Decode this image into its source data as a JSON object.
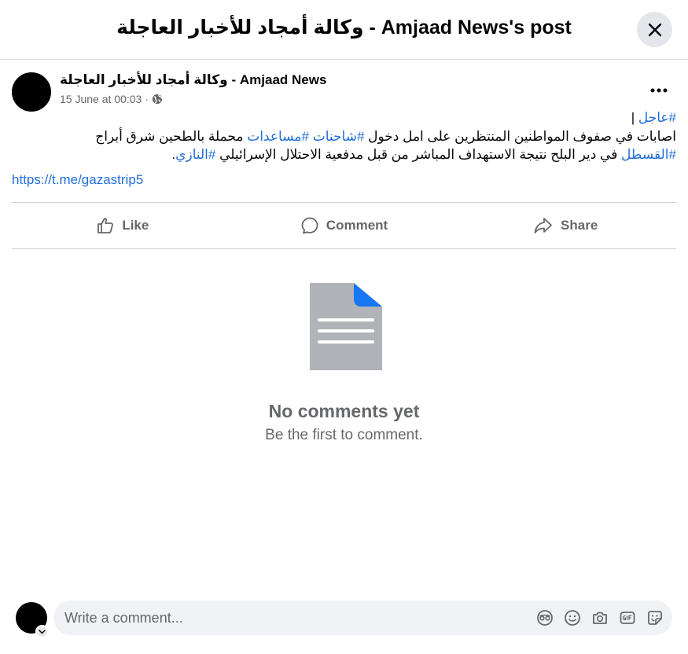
{
  "header": {
    "title": "وكالة أمجاد للأخبار العاجلة - Amjaad News's post"
  },
  "post": {
    "author": "وكالة أمجاد للأخبار العاجلة - Amjaad News",
    "timestamp": "15 June at 00:03",
    "separator": "·",
    "hashtag_breaking": "#عاجل",
    "pipe": " |",
    "text_line1_a": "اصابات في صفوف المواطنين المنتظرين على امل دخول ",
    "hashtag_trucks": "#شاحنات",
    "hashtag_aid": "#مساعدات",
    "text_line1_b": " محملة بالطحين شرق أبراج ",
    "hashtag_qastal": "#القسطل",
    "text_line2": " في دير البلح نتيجة الاستهداف المباشر من قبل مدفعية الاحتلال الإسرائيلي ",
    "hashtag_nazi": "#النازي",
    "period": ".",
    "link": "https://t.me/gazastrip5"
  },
  "actions": {
    "like": "Like",
    "comment": "Comment",
    "share": "Share"
  },
  "empty_state": {
    "title": "No comments yet",
    "subtitle": "Be the first to comment."
  },
  "composer": {
    "placeholder": "Write a comment..."
  },
  "colors": {
    "link": "#216fdb",
    "muted": "#65676b",
    "doc_gray": "#b0b3b8",
    "doc_corner": "#1877f2"
  }
}
